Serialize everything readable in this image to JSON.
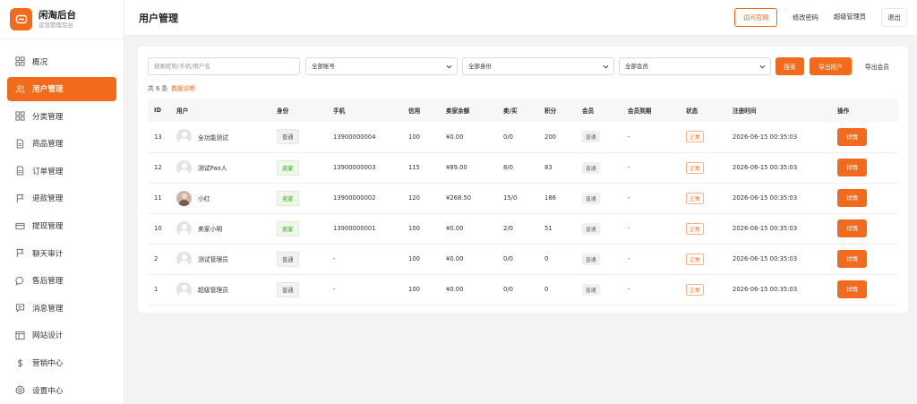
{
  "brand": {
    "name": "闲淘后台",
    "subtitle": "运营管理后台",
    "logo_icon": "chat-bubble-icon",
    "accent": "#f26a1b"
  },
  "sidebar": {
    "items": [
      {
        "label": "概况",
        "icon": "grid-icon",
        "active": false
      },
      {
        "label": "用户管理",
        "icon": "users-icon",
        "active": true
      },
      {
        "label": "分类管理",
        "icon": "grid-icon",
        "active": false
      },
      {
        "label": "商品管理",
        "icon": "document-icon",
        "active": false
      },
      {
        "label": "订单管理",
        "icon": "document-icon",
        "active": false
      },
      {
        "label": "退款管理",
        "icon": "flag-icon",
        "active": false
      },
      {
        "label": "提现管理",
        "icon": "card-icon",
        "active": false
      },
      {
        "label": "聊天审计",
        "icon": "flag-icon",
        "active": false
      },
      {
        "label": "售后管理",
        "icon": "chat-icon",
        "active": false
      },
      {
        "label": "消息管理",
        "icon": "message-icon",
        "active": false
      },
      {
        "label": "网站设计",
        "icon": "layout-icon",
        "active": false
      },
      {
        "label": "营销中心",
        "icon": "dollar-icon",
        "active": false
      },
      {
        "label": "设置中心",
        "icon": "gear-icon",
        "active": false
      }
    ]
  },
  "header": {
    "title": "用户管理",
    "visit_site": "访问官网",
    "change_password": "修改密码",
    "user": "超级管理员",
    "logout": "退出"
  },
  "filters": {
    "search_placeholder": "搜索昵称/手机/用户名",
    "account_select": "全部账号",
    "identity_select": "全部身份",
    "member_select": "全部会员",
    "search_btn": "搜索",
    "export_users_btn": "导出用户",
    "export_members_btn": "导出会员"
  },
  "summary": {
    "count_text": "共 6 条",
    "diag_link": "数据诊断"
  },
  "table": {
    "columns": [
      "ID",
      "用户",
      "身份",
      "手机",
      "信用",
      "卖家余额",
      "卖/买",
      "积分",
      "会员",
      "会员到期",
      "状态",
      "注册时间",
      "操作"
    ],
    "rows": [
      {
        "id": "13",
        "user": "全功能测试",
        "role": "普通",
        "role_type": "normal",
        "phone": "13900000004",
        "credit": "100",
        "balance": "¥0.00",
        "sell_buy": "0/0",
        "points": "200",
        "member": "普通",
        "expire": "-",
        "status": "正常",
        "registered": "2026-06-15 00:35:03",
        "action": "详情",
        "photo": false
      },
      {
        "id": "12",
        "user": "测试Pao人",
        "role": "卖家",
        "role_type": "seller",
        "phone": "13900000003",
        "credit": "115",
        "balance": "¥89.00",
        "sell_buy": "8/0",
        "points": "83",
        "member": "普通",
        "expire": "-",
        "status": "正常",
        "registered": "2026-06-15 00:35:03",
        "action": "详情",
        "photo": false
      },
      {
        "id": "11",
        "user": "小红",
        "role": "卖家",
        "role_type": "seller",
        "phone": "13900000002",
        "credit": "120",
        "balance": "¥268.50",
        "sell_buy": "15/0",
        "points": "186",
        "member": "普通",
        "expire": "-",
        "status": "正常",
        "registered": "2026-06-15 00:35:03",
        "action": "详情",
        "photo": true
      },
      {
        "id": "10",
        "user": "卖家小明",
        "role": "卖家",
        "role_type": "seller",
        "phone": "13900000001",
        "credit": "100",
        "balance": "¥0.00",
        "sell_buy": "2/0",
        "points": "51",
        "member": "普通",
        "expire": "-",
        "status": "正常",
        "registered": "2026-06-15 00:35:03",
        "action": "详情",
        "photo": false
      },
      {
        "id": "2",
        "user": "测试管理员",
        "role": "普通",
        "role_type": "normal",
        "phone": "-",
        "credit": "100",
        "balance": "¥0.00",
        "sell_buy": "0/0",
        "points": "0",
        "member": "普通",
        "expire": "-",
        "status": "正常",
        "registered": "2026-06-15 00:35:03",
        "action": "详情",
        "photo": false
      },
      {
        "id": "1",
        "user": "超级管理员",
        "role": "普通",
        "role_type": "normal",
        "phone": "-",
        "credit": "100",
        "balance": "¥0.00",
        "sell_buy": "0/0",
        "points": "0",
        "member": "普通",
        "expire": "-",
        "status": "正常",
        "registered": "2026-06-15 00:35:03",
        "action": "详情",
        "photo": false
      }
    ]
  }
}
